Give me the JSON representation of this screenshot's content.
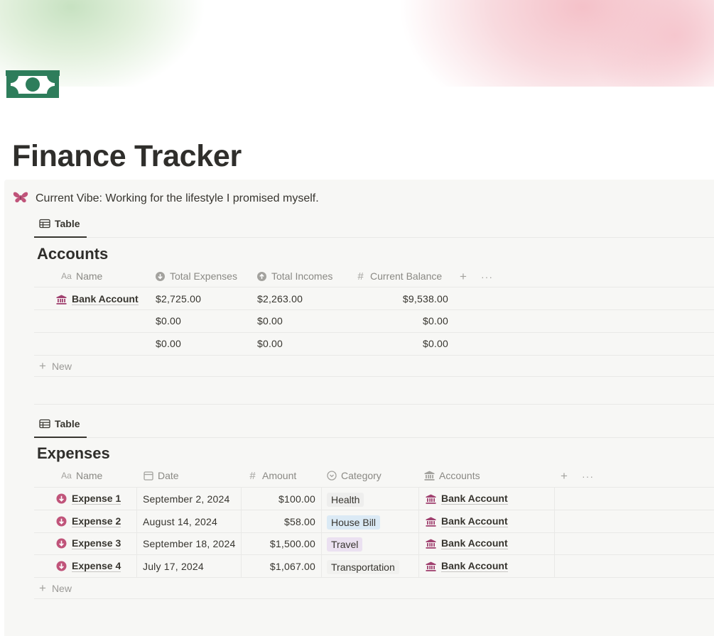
{
  "page": {
    "title": "Finance Tracker"
  },
  "callout": {
    "text": "Current Vibe: Working for the lifestyle I promised myself."
  },
  "accounts": {
    "view_label": "Table",
    "title": "Accounts",
    "columns": [
      "Name",
      "Total Expenses",
      "Total Incomes",
      "Current Balance"
    ],
    "rows": [
      {
        "name": "Bank Account",
        "total_expenses": "$2,725.00",
        "total_incomes": "$2,263.00",
        "current_balance": "$9,538.00"
      },
      {
        "name": "",
        "total_expenses": "$0.00",
        "total_incomes": "$0.00",
        "current_balance": "$0.00"
      },
      {
        "name": "",
        "total_expenses": "$0.00",
        "total_incomes": "$0.00",
        "current_balance": "$0.00"
      }
    ],
    "new_label": "New"
  },
  "expenses": {
    "view_label": "Table",
    "title": "Expenses",
    "columns": [
      "Name",
      "Date",
      "Amount",
      "Category",
      "Accounts"
    ],
    "rows": [
      {
        "name": "Expense 1",
        "date": "September 2, 2024",
        "amount": "$100.00",
        "category": "Health",
        "category_bg": "#eeeeed",
        "account": "Bank Account"
      },
      {
        "name": "Expense 2",
        "date": "August 14, 2024",
        "amount": "$58.00",
        "category": "House Bill",
        "category_bg": "#dbeaf5",
        "account": "Bank Account"
      },
      {
        "name": "Expense 3",
        "date": "September 18, 2024",
        "amount": "$1,500.00",
        "category": "Travel",
        "category_bg": "#ebe1f1",
        "account": "Bank Account"
      },
      {
        "name": "Expense 4",
        "date": "July 17, 2024",
        "amount": "$1,067.00",
        "category": "Transportation",
        "category_bg": "#f1f1ef",
        "account": "Bank Account"
      }
    ],
    "new_label": "New"
  },
  "icons": {
    "page": "money-bill-icon",
    "callout": "butterfly-icon",
    "account_row": "bank-icon",
    "expense_row": "arrow-down-circle-icon"
  },
  "colors": {
    "accent_green": "#2e7d5b",
    "accent_pink": "#c0547a",
    "bank_icon": "#a0416f"
  }
}
